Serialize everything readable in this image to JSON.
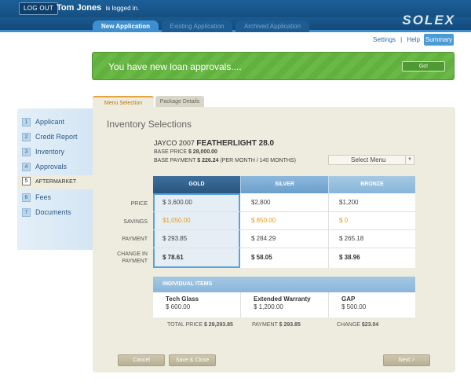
{
  "header": {
    "logout_label": "LOG OUT",
    "user_name": "Tom Jones",
    "logged_in_text": "is logged in.",
    "brand": "SOLEX",
    "nav_tabs": [
      {
        "label": "New Application",
        "active": true
      },
      {
        "label": "Existing Application",
        "active": false
      },
      {
        "label": "Archived Application",
        "active": false
      }
    ],
    "settings_label": "Settings",
    "separator": "|",
    "help_label": "Help",
    "summary_label": "Summary"
  },
  "banner": {
    "message": "You have new loan approvals....",
    "go_label": "Go!"
  },
  "sidebar": {
    "items": [
      {
        "num": "1",
        "label": "Applicant"
      },
      {
        "num": "2",
        "label": "Credit Report"
      },
      {
        "num": "3",
        "label": "Inventory"
      },
      {
        "num": "4",
        "label": "Approvals"
      },
      {
        "num": "5",
        "label": "AFTERMARKET"
      },
      {
        "num": "6",
        "label": "Fees"
      },
      {
        "num": "7",
        "label": "Documents"
      }
    ]
  },
  "panel": {
    "tabs": [
      {
        "label": "Menu Selection",
        "active": true
      },
      {
        "label": "Package Details",
        "active": false
      }
    ],
    "title": "Inventory Selections",
    "vehicle_year": "JAYCO 2007",
    "vehicle_model": "FEATHERLIGHT 28.0",
    "base_price_label": "BASE PRICE",
    "base_price_value": "$ 28,000.00",
    "base_payment_label": "BASE PAYMENT",
    "base_payment_value": "$ 226.24",
    "base_payment_terms": "(PER MONTH / 140 MONTHS)",
    "select_menu_value": "Select Menu"
  },
  "packages": {
    "row_labels": [
      "PRICE",
      "SAVINGS",
      "PAYMENT",
      "CHANGE IN PAYMENT"
    ],
    "columns": [
      {
        "name": "GOLD",
        "price": "$ 3,600.00",
        "savings": "$1,050.00",
        "payment": "$ 293.85",
        "change": "$ 78.61"
      },
      {
        "name": "SILVER",
        "price": "$2,800",
        "savings": "$ 850.00",
        "payment": "$ 284.29",
        "change": "$ 58.05"
      },
      {
        "name": "BRONZE",
        "price": "$1,200",
        "savings": "$ 0",
        "payment": "$ 265.18",
        "change": "$ 38.96"
      }
    ]
  },
  "individual": {
    "header": "INDIVIDUAL ITEMS",
    "items": [
      {
        "name": "Tech Glass",
        "price": "$ 600.00"
      },
      {
        "name": "Extended Warranty",
        "price": "$ 1,200.00"
      },
      {
        "name": "GAP",
        "price": "$ 500.00"
      }
    ]
  },
  "totals": {
    "total_price_label": "TOTAL PRICE",
    "total_price_value": "$ 29,293.85",
    "payment_label": "PAYMENT",
    "payment_value": "$ 293.85",
    "change_label": "CHANGE",
    "change_value": "$23.04"
  },
  "buttons": {
    "cancel": "Cancel",
    "save_close": "Save & Close",
    "next": "Next >"
  }
}
